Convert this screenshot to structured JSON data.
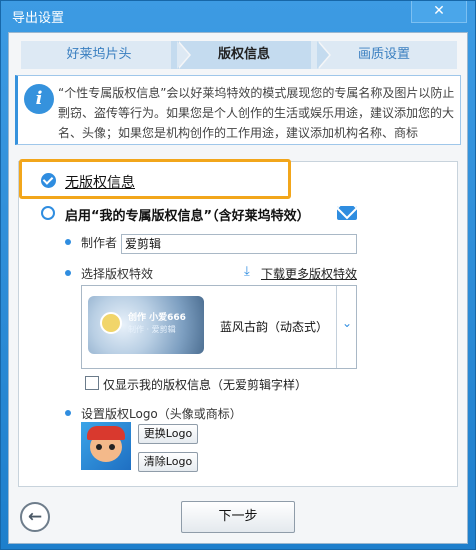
{
  "window": {
    "title": "导出设置",
    "close_glyph": "✕"
  },
  "steps": [
    {
      "label": "好莱坞片头",
      "active": false
    },
    {
      "label": "版权信息",
      "active": true
    },
    {
      "label": "画质设置",
      "active": false
    }
  ],
  "notice": {
    "icon": "info-icon",
    "icon_glyph": "i",
    "text": "“个性专属版权信息”会以好莱坞特效的模式展现您的专属名称及图片以防止剽窃、盗传等行为。如果您是个人创作的生活或娱乐用途，建议添加您的大名、头像；如果您是机构创作的工作用途，建议添加机构名称、商标"
  },
  "copyright_options": {
    "no_copyright_label": "无版权信息",
    "no_copyright_selected": true,
    "custom_copyright_label": "启用“我的专属版权信息”（含好莱坞特效）",
    "custom_copyright_selected": false
  },
  "author": {
    "label": "制作者",
    "value": "爱剪辑"
  },
  "effect": {
    "label": "选择版权特效",
    "download_label": "下载更多版权特效",
    "download_icon_glyph": "⤓",
    "selected_name": "蓝风古韵（动态式）",
    "thumb_title": "创作 小爱666",
    "thumb_sub": "制作 · 爱剪辑",
    "chevron_glyph": "⌄"
  },
  "only_mine": {
    "label": "仅显示我的版权信息（无爱剪辑字样）",
    "checked": false
  },
  "logo": {
    "label": "设置版权Logo（头像或商标）",
    "replace_label": "更换Logo",
    "clear_label": "清除Logo"
  },
  "footer": {
    "back_glyph": "←",
    "next_label": "下一步"
  },
  "colors": {
    "accent": "#2f8de0",
    "highlight": "#f2a61b",
    "titlebar": "#2a8fd8"
  }
}
